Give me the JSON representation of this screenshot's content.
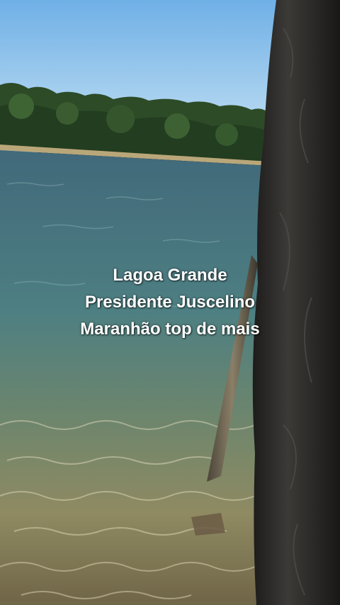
{
  "caption": {
    "line1": "Lagoa Grande",
    "line2": "Presidente Juscelino",
    "line3": "Maranhão top de mais"
  },
  "colors": {
    "sky": "#8cc3ee",
    "water_deep": "#3f6b7c",
    "water_shallow": "#8a8a62",
    "trees": "#2c4a26",
    "trunk": "#2b2a28"
  }
}
